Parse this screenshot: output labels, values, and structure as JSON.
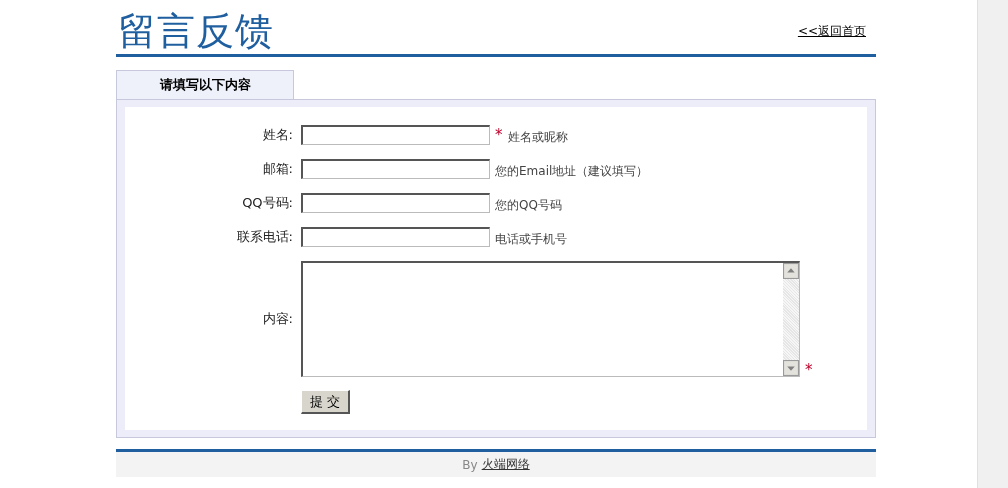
{
  "header": {
    "title": "留言反馈",
    "back_link": "<<返回首页"
  },
  "tabs": [
    {
      "label": "请填写以下内容",
      "selected": true
    }
  ],
  "form": {
    "fields": [
      {
        "kind": "input",
        "label": "姓名:",
        "required_mark": "*",
        "hint": "姓名或昵称"
      },
      {
        "kind": "input",
        "label": "邮箱:",
        "hint": "您的Email地址（建议填写）"
      },
      {
        "kind": "input",
        "label": "QQ号码:",
        "hint": "您的QQ号码"
      },
      {
        "kind": "input",
        "label": "联系电话:",
        "hint": "电话或手机号"
      },
      {
        "kind": "textarea",
        "label": "内容:",
        "required_mark": "*"
      }
    ],
    "submit": "提 交"
  },
  "footer": {
    "prefix": "By",
    "link": "火端网络"
  }
}
